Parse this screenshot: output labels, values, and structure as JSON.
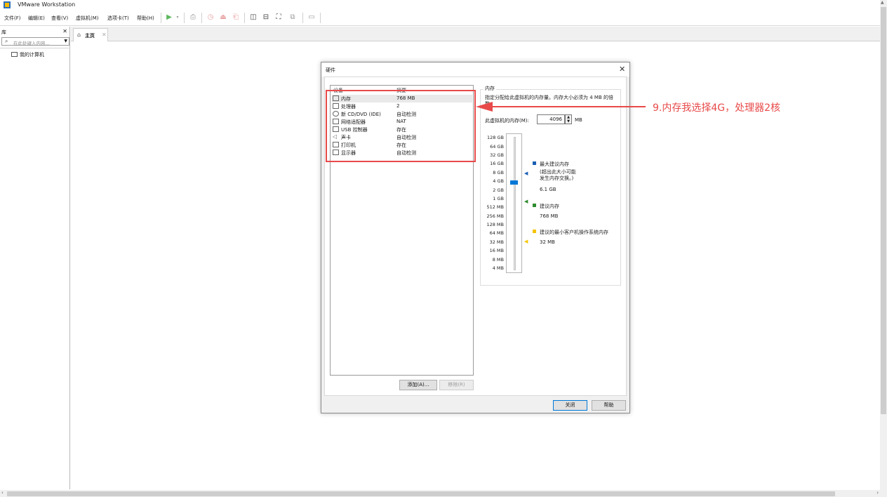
{
  "window": {
    "title": "VMware Workstation"
  },
  "menu": [
    {
      "label": "文件(F)"
    },
    {
      "label": "编辑(E)"
    },
    {
      "label": "查看(V)"
    },
    {
      "label": "虚拟机(M)"
    },
    {
      "label": "选项卡(T)"
    },
    {
      "label": "帮助(H)"
    }
  ],
  "toolbar": {
    "icons": [
      "play-icon",
      "dropdown-icon",
      "send-keys-icon",
      "snapshot-icon",
      "revert-snapshot-icon",
      "manage-snapshots-icon",
      "library-view-icon",
      "thumbnail-bar-icon",
      "fullscreen-icon",
      "unity-icon",
      "console-view-icon"
    ]
  },
  "library": {
    "title": "库",
    "search_placeholder": "在此处键入内容...",
    "tree": [
      {
        "label": "我的计算机"
      }
    ]
  },
  "tabs": [
    {
      "label": "主页"
    }
  ],
  "dialog": {
    "title": "硬件",
    "columns": {
      "device": "设备",
      "summary": "摘要"
    },
    "devices": [
      {
        "name": "内存",
        "summary": "768 MB",
        "icon": "memory-icon",
        "selected": true
      },
      {
        "name": "处理器",
        "summary": "2",
        "icon": "cpu-icon"
      },
      {
        "name": "新 CD/DVD (IDE)",
        "summary": "自动检测",
        "icon": "cd-dvd-icon"
      },
      {
        "name": "网络适配器",
        "summary": "NAT",
        "icon": "network-adapter-icon"
      },
      {
        "name": "USB 控制器",
        "summary": "存在",
        "icon": "usb-icon"
      },
      {
        "name": "声卡",
        "summary": "自动检测",
        "icon": "sound-card-icon"
      },
      {
        "name": "打印机",
        "summary": "存在",
        "icon": "printer-icon"
      },
      {
        "name": "显示器",
        "summary": "自动检测",
        "icon": "display-icon"
      }
    ],
    "add_button": "添加(A)...",
    "remove_button": "移除(R)",
    "close_button": "关闭",
    "help_button": "帮助",
    "memory": {
      "group_title": "内存",
      "description": "指定分配给此虚拟机的内存量。内存大小必须为 4 MB 的倍数。",
      "field_label": "此虚拟机的内存(M):",
      "value": "4096",
      "unit": "MB",
      "scale": [
        "128 GB",
        "64 GB",
        "32 GB",
        "16 GB",
        "8 GB",
        "4 GB",
        "2 GB",
        "1 GB",
        "512 MB",
        "256 MB",
        "128 MB",
        "64 MB",
        "32 MB",
        "16 MB",
        "8 MB",
        "4 MB"
      ],
      "legend": [
        {
          "label": "最大建议内存",
          "note": "(超出此大小可能\n发生内存交换。)",
          "value": "6.1 GB",
          "color": "#1a5fb4"
        },
        {
          "label": "建议内存",
          "value": "768 MB",
          "color": "#2e8b2e"
        },
        {
          "label": "建议的最小客户机操作系统内存",
          "value": "32 MB",
          "color": "#f5c400"
        }
      ]
    }
  },
  "annotation": {
    "text": "9.内存我选择4G，处理器2核",
    "color": "#e84a4a"
  }
}
